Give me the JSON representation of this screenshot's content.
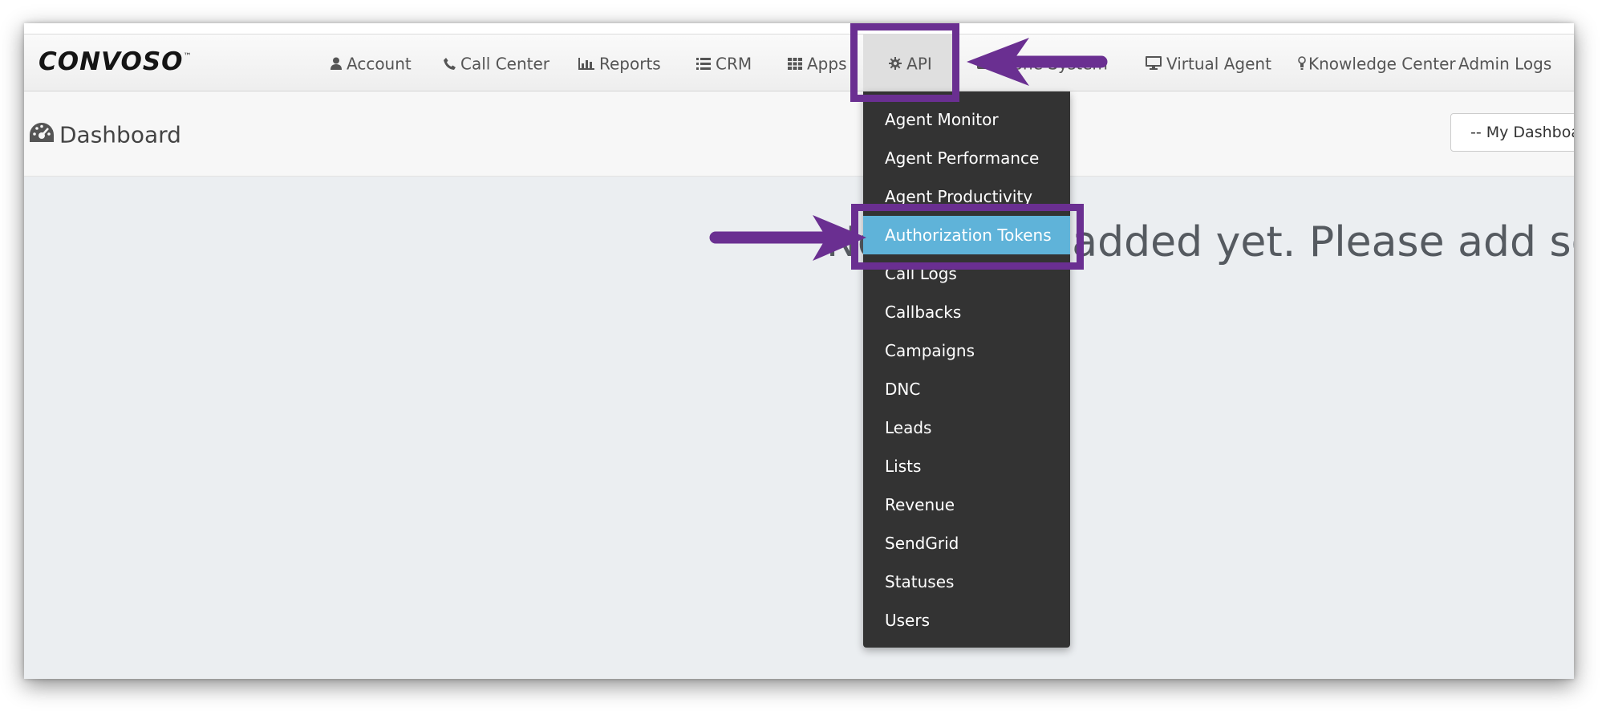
{
  "app": {
    "logo": "CONVOSO",
    "logo_mark": "™"
  },
  "nav": {
    "items": [
      {
        "label": "Account",
        "icon": "user-icon"
      },
      {
        "label": "Call Center",
        "icon": "phone-icon"
      },
      {
        "label": "Reports",
        "icon": "bar-chart-icon"
      },
      {
        "label": "CRM",
        "icon": "list-icon"
      },
      {
        "label": "Apps",
        "icon": "grid-icon"
      },
      {
        "label": "API",
        "icon": "gear-icon"
      },
      {
        "label": "Phone System",
        "icon": "phone-system-icon"
      },
      {
        "label": "Virtual Agent",
        "icon": "monitor-icon"
      },
      {
        "label": "Knowledge Center",
        "icon": "lightbulb-icon"
      },
      {
        "label": "Admin Logs",
        "icon": ""
      }
    ],
    "active": "API"
  },
  "page": {
    "title": "Dashboard",
    "title_icon": "dashboard-gauge-icon",
    "dashboard_select": "-- My Dashboards --",
    "empty_message": "No widgets added yet. Please add some."
  },
  "dropdown": {
    "items": [
      "Agent Monitor",
      "Agent Performance",
      "Agent Productivity",
      "Authorization Tokens",
      "Call Logs",
      "Callbacks",
      "Campaigns",
      "DNC",
      "Leads",
      "Lists",
      "Revenue",
      "SendGrid",
      "Statuses",
      "Users"
    ],
    "highlighted": "Authorization Tokens"
  },
  "colors": {
    "annotation": "#6a2f91",
    "dropdown_bg": "#333333",
    "dropdown_highlight": "#5fb3d9",
    "content_bg": "#ebeef1"
  }
}
